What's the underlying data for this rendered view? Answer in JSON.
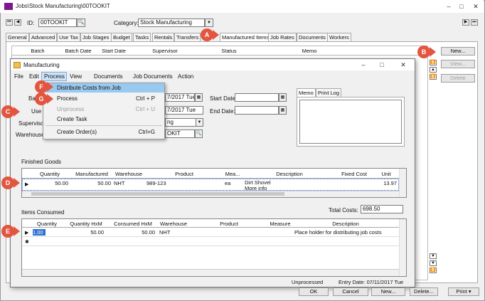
{
  "window": {
    "title": "Jobs\\Stock Manufacturing\\00TOOKIT",
    "minimize": "–",
    "maximize": "□",
    "close": "✕"
  },
  "header": {
    "id_label": "ID:",
    "id_value": "00TOOKIT",
    "category_label": "Category:",
    "category_value": "Stock Manufacturing",
    "nav_first": "⏮",
    "nav_prev": "◀",
    "nav_next": "▶",
    "nav_last": "⏭"
  },
  "tabs": [
    "General",
    "Advanced",
    "Use Tax",
    "Job Stages",
    "Budget",
    "Tasks",
    "Rentals",
    "Transfers",
    "Manufactured Items",
    "Job Rates",
    "Documents",
    "Workers"
  ],
  "main_grid": {
    "columns": [
      "Batch",
      "Batch Date",
      "Start Date",
      "Supervisor",
      "Status",
      "Memo"
    ]
  },
  "side_buttons": {
    "new": "New...",
    "view": "View...",
    "delete": "Delete"
  },
  "bottom_buttons": {
    "ok": "OK",
    "cancel": "Cancel",
    "new": "New...",
    "delete": "Delete...",
    "print": "Print"
  },
  "modal": {
    "title": "Manufacturing",
    "menu": [
      "File",
      "Edit",
      "Process",
      "View",
      "Documents",
      "Job Documents",
      "Action"
    ],
    "dropdown": [
      {
        "label": "Distribute Costs from Job",
        "shortcut": "",
        "disabled": false,
        "highlighted": true
      },
      {
        "label": "Process",
        "shortcut": "Ctrl + P",
        "disabled": false,
        "highlighted": false
      },
      {
        "label": "Unprocess",
        "shortcut": "Ctrl + U",
        "disabled": true,
        "highlighted": false
      },
      {
        "label": "Create Task",
        "shortcut": "",
        "disabled": false,
        "highlighted": false
      },
      {
        "label": "Create Order(s)",
        "shortcut": "Ctrl+G",
        "disabled": false,
        "highlighted": false
      }
    ],
    "partial_labels": {
      "batch": "Ba",
      "user": "Use",
      "supervisor": "Supervisor",
      "warehouse": "Warehouse"
    },
    "batch_date": "7/2017 Tue",
    "user_date": "7/2017 Tue",
    "supervisor_value": "ng",
    "warehouse_value": "OKIT",
    "start_date_label": "Start Date:",
    "end_date_label": "End Date:",
    "memo_tabs": [
      "Memo",
      "Print Log"
    ],
    "finished_goods": {
      "label": "Finished Goods",
      "columns": [
        "Quantity",
        "Manufactured",
        "Warehouse",
        "Product",
        "Mea...",
        "Description",
        "Fixed Cost",
        "Unit"
      ],
      "row": {
        "quantity": "50.00",
        "manufactured": "50.00",
        "warehouse": "NHT",
        "product": "989-123",
        "measure": "ea",
        "description": "Dirt Shovel",
        "description2": "More info",
        "fixed_cost": "",
        "unit": "13.97"
      }
    },
    "items_consumed": {
      "label": "Items Consumed",
      "total_costs_label": "Total Costs:",
      "total_costs_value": "698.50",
      "columns": [
        "Quantity",
        "Quantity HxM",
        "Consumed HxM",
        "Warehouse",
        "Product",
        "Measure",
        "Description"
      ],
      "row": {
        "quantity": "1.00",
        "quantity_hxm": "50.00",
        "consumed_hxm": "50.00",
        "warehouse": "NHT",
        "product": "",
        "measure": "",
        "description": "Place holder for distributing job costs"
      }
    },
    "status": "Unprocessed",
    "entry_date": "Entry Date: 07/11/2017 Tue"
  },
  "callouts": [
    "A",
    "B",
    "C",
    "D",
    "E",
    "F",
    "G"
  ],
  "colors": {
    "callout": "#e2553f",
    "highlight": "#99c9ef",
    "selection": "#2f6fd1"
  }
}
